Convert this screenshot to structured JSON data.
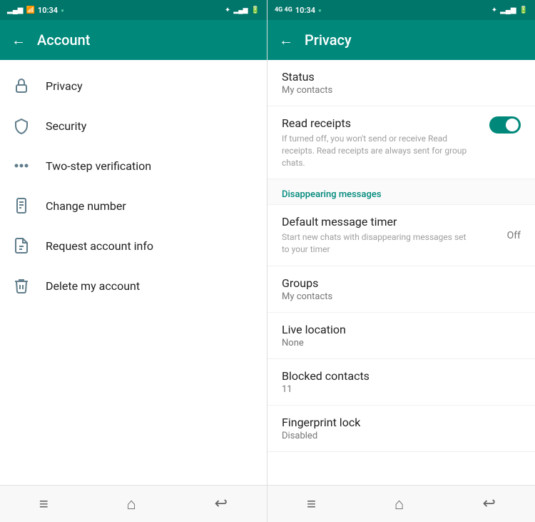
{
  "left_panel": {
    "status_bar": {
      "time": "10:34",
      "dot_icon": "●"
    },
    "header": {
      "title": "Account",
      "back_label": "←"
    },
    "menu_items": [
      {
        "id": "privacy",
        "label": "Privacy",
        "icon": "lock"
      },
      {
        "id": "security",
        "label": "Security",
        "icon": "shield"
      },
      {
        "id": "two-step",
        "label": "Two-step verification",
        "icon": "dots"
      },
      {
        "id": "change-number",
        "label": "Change number",
        "icon": "phone-edit"
      },
      {
        "id": "request-info",
        "label": "Request account info",
        "icon": "doc"
      },
      {
        "id": "delete-account",
        "label": "Delete my account",
        "icon": "trash"
      }
    ],
    "bottom_nav": {
      "menu_icon": "≡",
      "home_icon": "⌂",
      "back_icon": "↩"
    }
  },
  "right_panel": {
    "status_bar": {
      "time": "10:34",
      "dot_icon": "●"
    },
    "header": {
      "title": "Privacy",
      "back_label": "←"
    },
    "privacy_items": [
      {
        "id": "status",
        "title": "Status",
        "subtitle": "My contacts",
        "value": "",
        "has_toggle": false,
        "description": ""
      },
      {
        "id": "read-receipts",
        "title": "Read receipts",
        "subtitle": "",
        "value": "",
        "has_toggle": true,
        "description": "If turned off, you won't send or receive Read receipts. Read receipts are always sent for group chats."
      }
    ],
    "section_label": "Disappearing messages",
    "disappearing_items": [
      {
        "id": "default-timer",
        "title": "Default message timer",
        "subtitle": "Start new chats with disappearing messages set to your timer",
        "value": "Off"
      }
    ],
    "other_items": [
      {
        "id": "groups",
        "title": "Groups",
        "subtitle": "My contacts",
        "value": ""
      },
      {
        "id": "live-location",
        "title": "Live location",
        "subtitle": "None",
        "value": ""
      },
      {
        "id": "blocked-contacts",
        "title": "Blocked contacts",
        "subtitle": "11",
        "value": ""
      },
      {
        "id": "fingerprint-lock",
        "title": "Fingerprint lock",
        "subtitle": "Disabled",
        "value": ""
      }
    ],
    "bottom_nav": {
      "menu_icon": "≡",
      "home_icon": "⌂",
      "back_icon": "↩"
    }
  }
}
